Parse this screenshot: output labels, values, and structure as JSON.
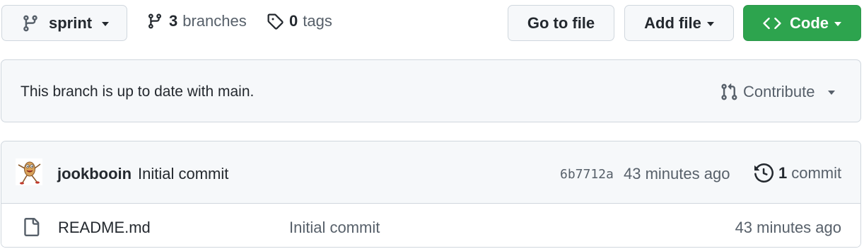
{
  "toolbar": {
    "branch_selector": {
      "label": "sprint",
      "icon": "git-branch-icon"
    },
    "branches": {
      "count": "3",
      "label": "branches",
      "icon": "git-branch-icon"
    },
    "tags": {
      "count": "0",
      "label": "tags",
      "icon": "tag-icon"
    },
    "go_to_file_label": "Go to file",
    "add_file_label": "Add file",
    "code": {
      "label": "Code",
      "icon": "code-icon"
    }
  },
  "banner": {
    "text": "This branch is up to date with main.",
    "contribute_label": "Contribute",
    "contribute_icon": "git-pull-request-icon"
  },
  "latest_commit": {
    "author": "jookbooin",
    "message": "Initial commit",
    "sha": "6b7712a",
    "time": "43 minutes ago",
    "history": {
      "count": "1",
      "label": "commit",
      "icon": "history-icon"
    }
  },
  "files": [
    {
      "name": "README.md",
      "icon": "file-icon",
      "commit_message": "Initial commit",
      "time": "43 minutes ago"
    }
  ],
  "colors": {
    "accent_green": "#2da44e",
    "border": "#d0d7de",
    "muted_text": "#57606a",
    "surface": "#f6f8fa"
  }
}
